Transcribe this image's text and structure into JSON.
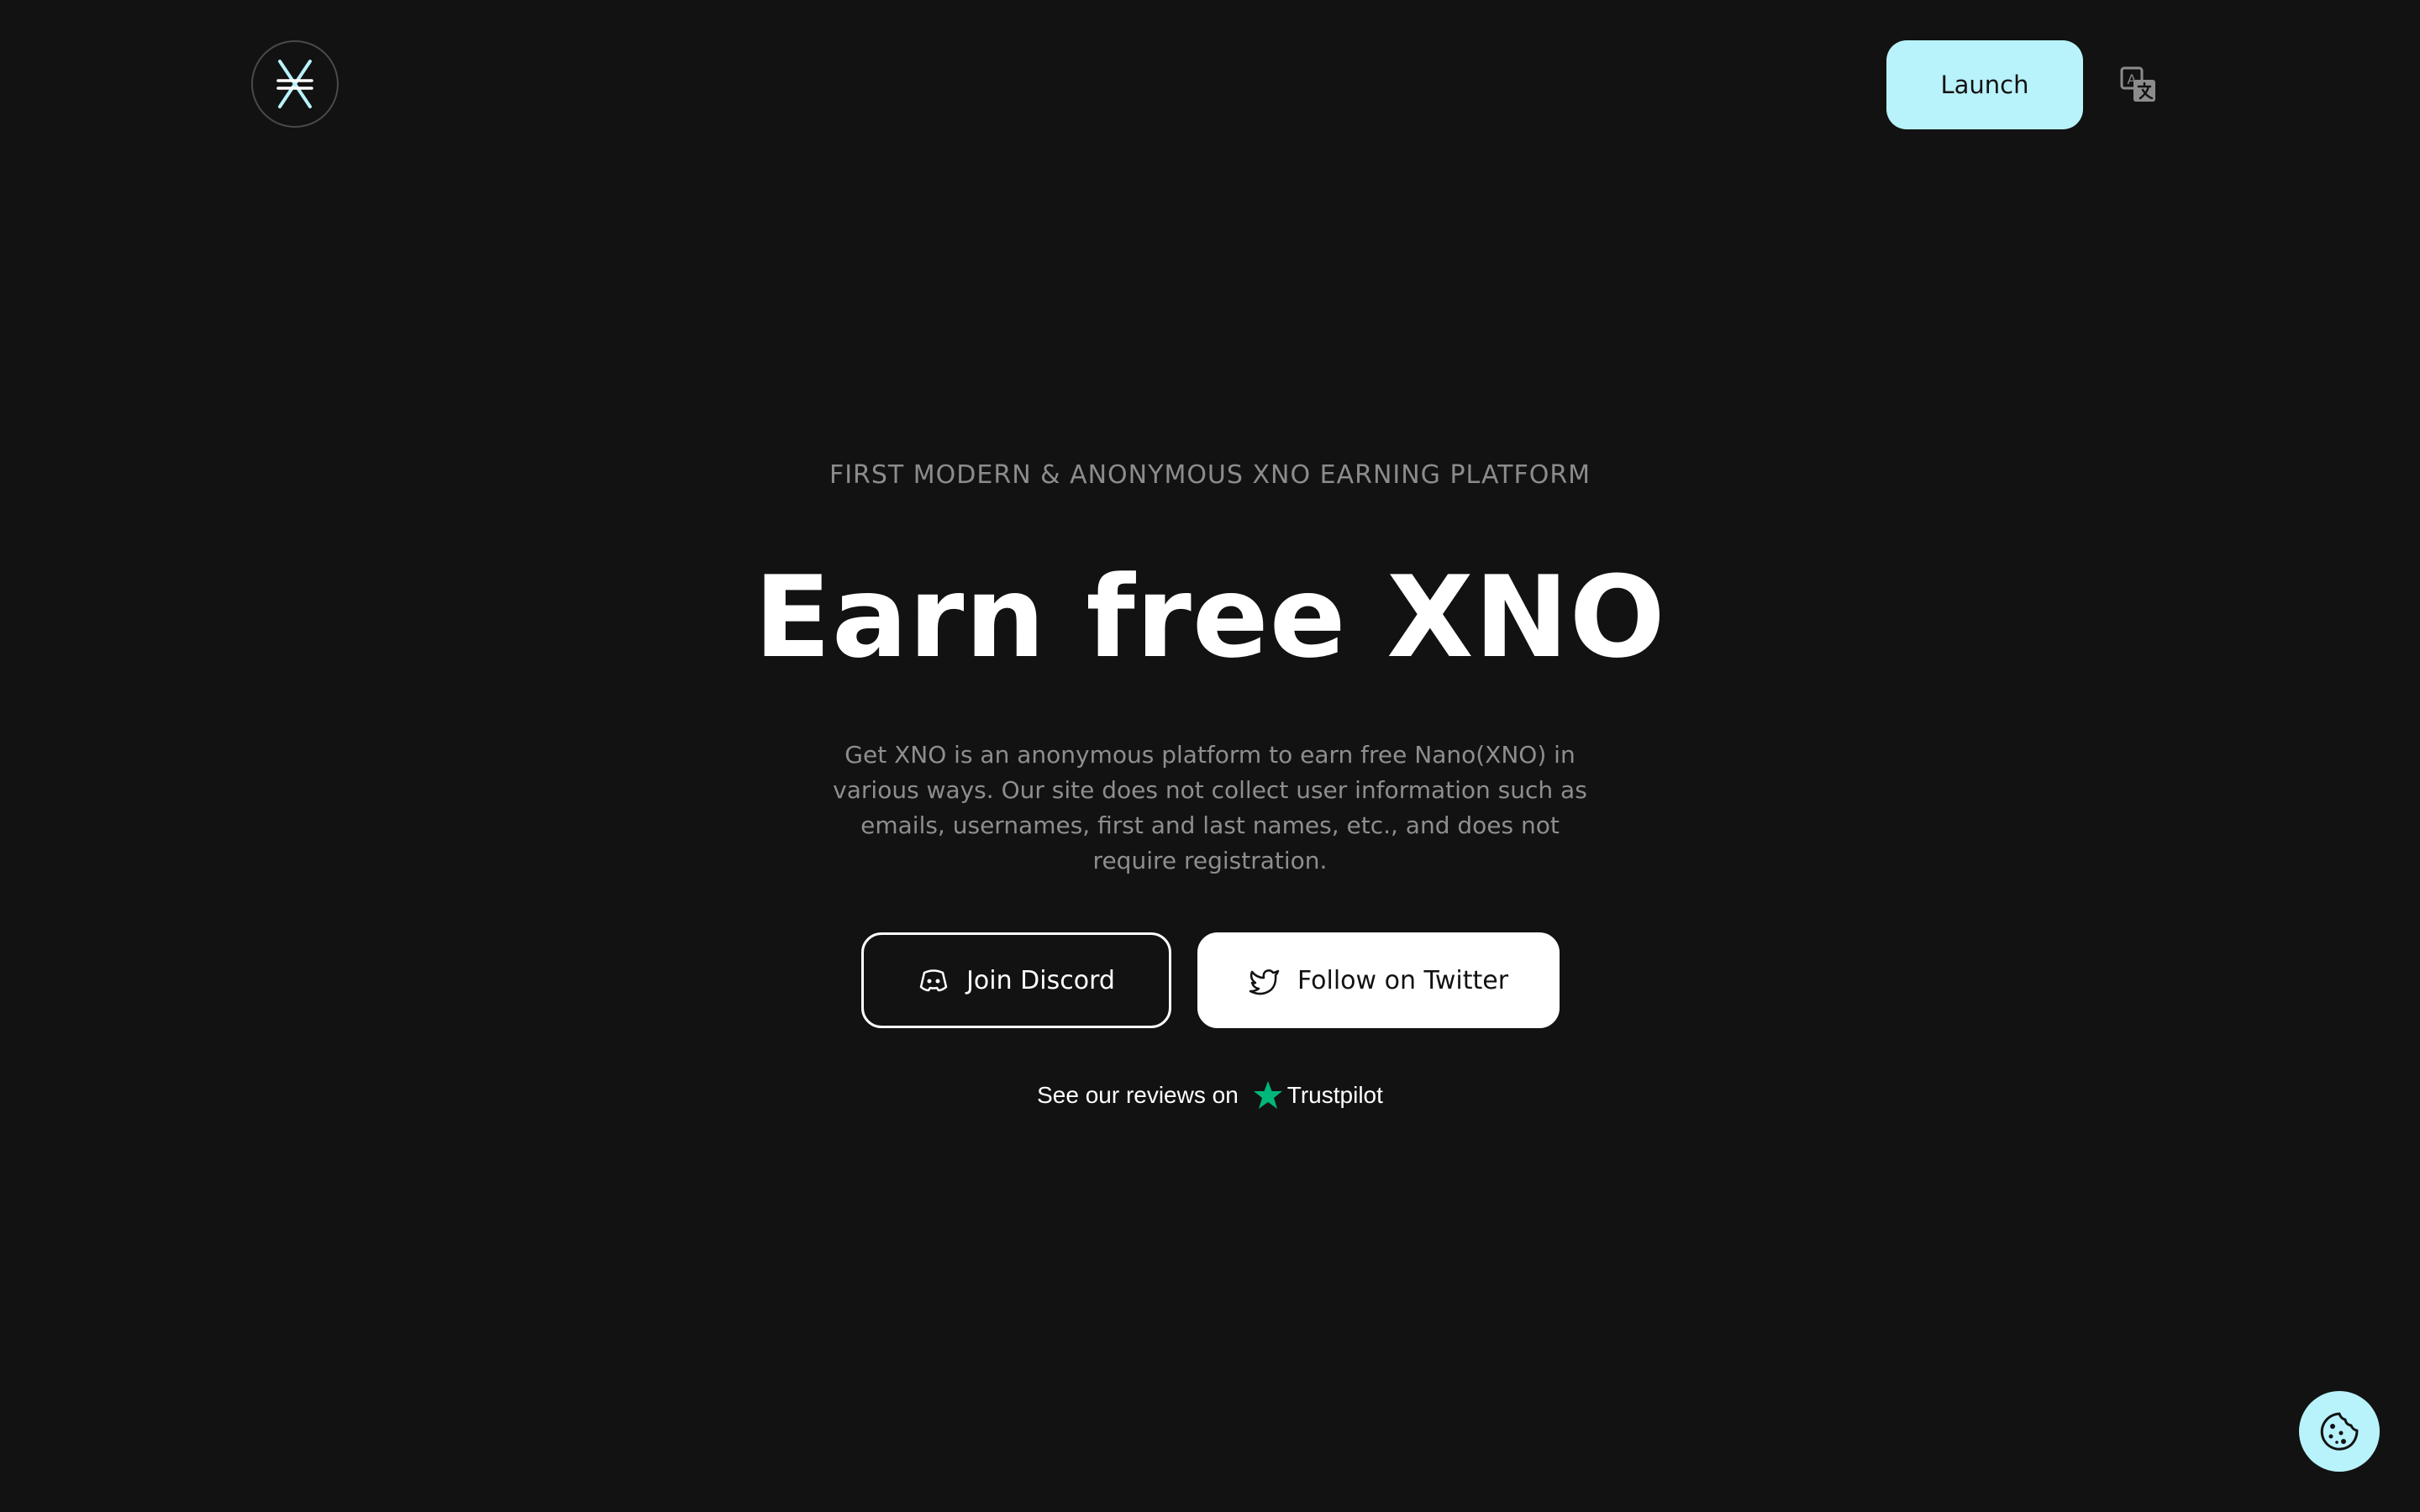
{
  "header": {
    "logo_icon": "xno-logo-icon",
    "launch_label": "Launch",
    "translate_icon": "translate-icon"
  },
  "hero": {
    "eyebrow": "FIRST MODERN & ANONYMOUS XNO EARNING PLATFORM",
    "title": "Earn free XNO",
    "description": "Get XNO is an anonymous platform to earn free Nano(XNO) in various ways. Our site does not collect user information such as emails, usernames, first and last names, etc., and does not require registration."
  },
  "actions": {
    "discord_label": "Join Discord",
    "discord_icon": "discord-icon",
    "twitter_label": "Follow on Twitter",
    "twitter_icon": "twitter-icon"
  },
  "reviews": {
    "prefix": "See our reviews on",
    "brand": "Trustpilot",
    "star_icon": "trustpilot-star-icon"
  },
  "cookie": {
    "icon": "cookie-icon"
  },
  "colors": {
    "background": "#121212",
    "accent": "#b8f2fb",
    "trustpilot_green": "#00b67a",
    "muted_text": "#8c8c8c"
  }
}
